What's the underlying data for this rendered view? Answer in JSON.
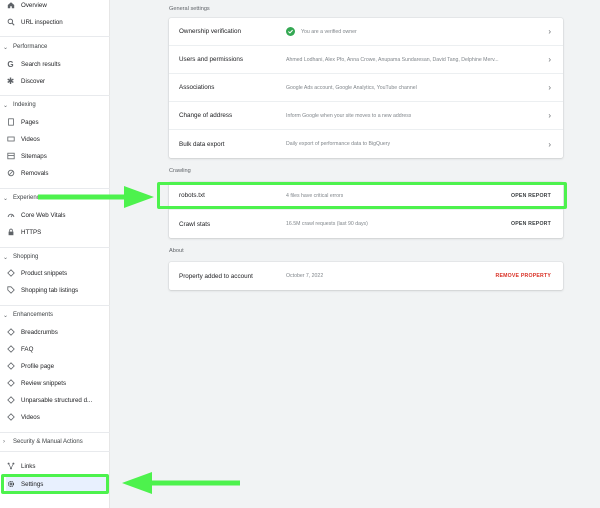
{
  "sidebar": {
    "top_items": [
      {
        "label": "Overview",
        "icon": "home-icon"
      },
      {
        "label": "URL inspection",
        "icon": "search-icon"
      }
    ],
    "sections": {
      "performance": {
        "title": "Performance",
        "items": [
          "Search results",
          "Discover"
        ]
      },
      "indexing": {
        "title": "Indexing",
        "items": [
          "Pages",
          "Videos",
          "Sitemaps",
          "Removals"
        ]
      },
      "experience": {
        "title": "Experience",
        "items": [
          "Core Web Vitals",
          "HTTPS"
        ]
      },
      "shopping": {
        "title": "Shopping",
        "items": [
          "Product snippets",
          "Shopping tab listings"
        ]
      },
      "enhancements": {
        "title": "Enhancements",
        "items": [
          "Breadcrumbs",
          "FAQ",
          "Profile page",
          "Review snippets",
          "Unparsable structured d...",
          "Videos"
        ]
      },
      "security": {
        "title": "Security & Manual Actions"
      }
    },
    "bottom_items": [
      {
        "label": "Links",
        "icon": "links-icon"
      },
      {
        "label": "Settings",
        "icon": "gear-icon"
      }
    ]
  },
  "general": {
    "heading": "General settings",
    "rows": [
      {
        "label": "Ownership verification",
        "value": "You are a verified owner"
      },
      {
        "label": "Users and permissions",
        "value": "Ahmed Lodhani, Alex Pfo, Anna Crowe, Anupama Sundaresan, David Tang, Delphine Merv..."
      },
      {
        "label": "Associations",
        "value": "Google Ads account, Google Analytics, YouTube channel"
      },
      {
        "label": "Change of address",
        "value": "Inform Google when your site moves to a new address"
      },
      {
        "label": "Bulk data export",
        "value": "Daily export of performance data to BigQuery"
      }
    ]
  },
  "crawling": {
    "heading": "Crawling",
    "rows": [
      {
        "label": "robots.txt",
        "value": "4 files have critical errors",
        "action": "OPEN REPORT"
      },
      {
        "label": "Crawl stats",
        "value": "16.5M crawl requests (last 90 days)",
        "action": "OPEN REPORT"
      }
    ]
  },
  "about": {
    "heading": "About",
    "row": {
      "label": "Property added to account",
      "value": "October 7, 2022",
      "action": "REMOVE PROPERTY"
    }
  },
  "colors": {
    "highlight": "#4df24d",
    "accent_blue": "#1a73e8",
    "danger": "#d93025",
    "verified": "#34a853"
  }
}
